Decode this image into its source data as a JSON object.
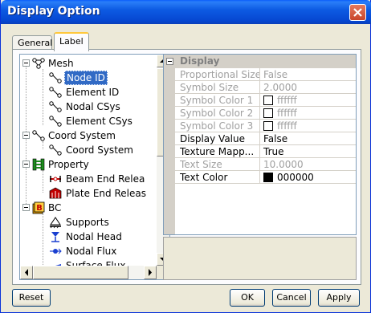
{
  "window": {
    "title": "Display Option"
  },
  "tabs": [
    {
      "label": "General"
    },
    {
      "label": "Label"
    }
  ],
  "tree": {
    "items": [
      {
        "label": "Mesh"
      },
      {
        "label": "Node ID",
        "selected": true
      },
      {
        "label": "Element ID"
      },
      {
        "label": "Nodal CSys"
      },
      {
        "label": "Element CSys"
      },
      {
        "label": "Coord System"
      },
      {
        "label": "Coord System"
      },
      {
        "label": "Property"
      },
      {
        "label": "Beam End Relea"
      },
      {
        "label": "Plate End Releas"
      },
      {
        "label": "BC"
      },
      {
        "label": "Supports"
      },
      {
        "label": "Nodal Head"
      },
      {
        "label": "Nodal Flux"
      },
      {
        "label": "Surface Flux"
      }
    ]
  },
  "properties": {
    "group": "Display",
    "rows": [
      {
        "name": "Proportional Size",
        "value": "False",
        "enabled": false
      },
      {
        "name": "Symbol Size",
        "value": "2.0000",
        "enabled": false
      },
      {
        "name": "Symbol Color 1",
        "value": "ffffff",
        "enabled": false,
        "color": "#ffffff"
      },
      {
        "name": "Symbol Color 2",
        "value": "ffffff",
        "enabled": false,
        "color": "#ffffff"
      },
      {
        "name": "Symbol Color 3",
        "value": "ffffff",
        "enabled": false,
        "color": "#ffffff"
      },
      {
        "name": "Display Value",
        "value": "False",
        "enabled": true
      },
      {
        "name": "Texture Mapp...",
        "value": "True",
        "enabled": true
      },
      {
        "name": "Text Size",
        "value": "10.0000",
        "enabled": false
      },
      {
        "name": "Text Color",
        "value": "000000",
        "enabled": true,
        "color": "#000000"
      }
    ]
  },
  "buttons": {
    "reset": "Reset",
    "ok": "OK",
    "cancel": "Cancel",
    "apply": "Apply"
  }
}
